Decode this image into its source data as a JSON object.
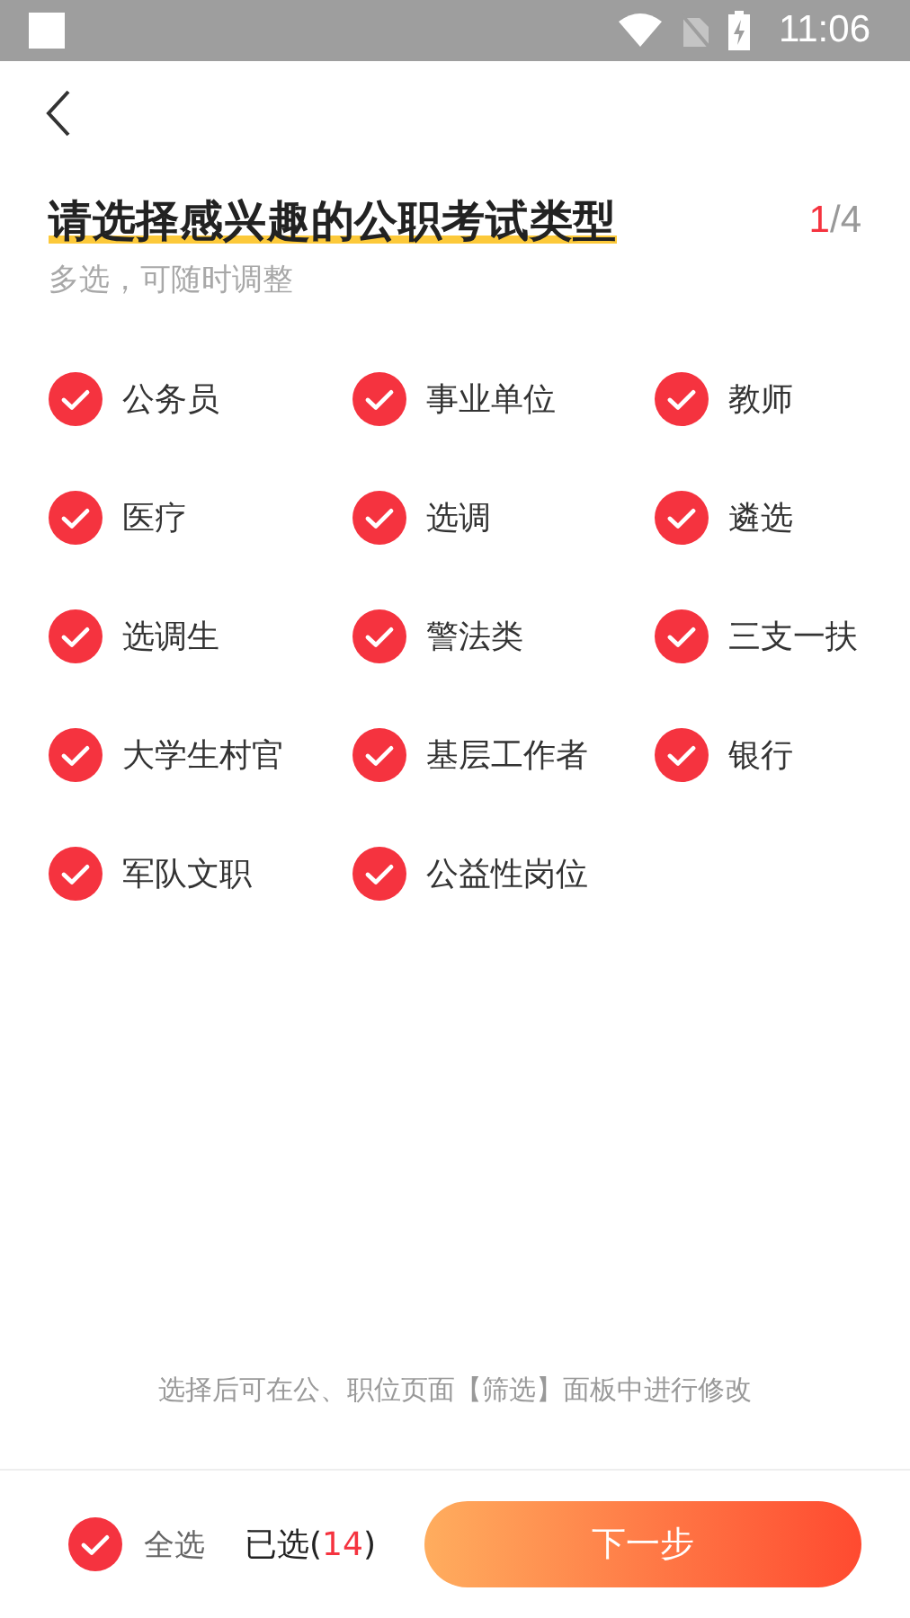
{
  "status_bar": {
    "time": "11:06"
  },
  "header": {
    "title": "请选择感兴趣的公职考试类型",
    "step": "1",
    "step_total": "/4",
    "subtitle": "多选，可随时调整"
  },
  "options": [
    {
      "label": "公务员",
      "checked": true
    },
    {
      "label": "事业单位",
      "checked": true
    },
    {
      "label": "教师",
      "checked": true
    },
    {
      "label": "医疗",
      "checked": true
    },
    {
      "label": "选调",
      "checked": true
    },
    {
      "label": "遴选",
      "checked": true
    },
    {
      "label": "选调生",
      "checked": true
    },
    {
      "label": "警法类",
      "checked": true
    },
    {
      "label": "三支一扶",
      "checked": true
    },
    {
      "label": "大学生村官",
      "checked": true
    },
    {
      "label": "基层工作者",
      "checked": true
    },
    {
      "label": "银行",
      "checked": true
    },
    {
      "label": "军队文职",
      "checked": true
    },
    {
      "label": "公益性岗位",
      "checked": true
    }
  ],
  "hint": "选择后可在公、职位页面【筛选】面板中进行修改",
  "footer": {
    "select_all": {
      "label": "全选",
      "checked": true
    },
    "selected_prefix": "已选(",
    "selected_count": "14",
    "selected_suffix": ")",
    "next_button": "下一步"
  }
}
